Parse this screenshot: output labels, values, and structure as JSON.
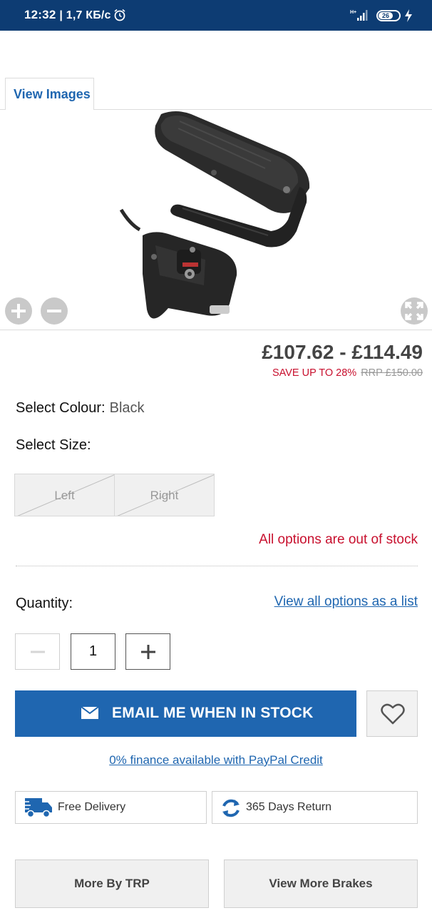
{
  "status_bar": {
    "time": "12:32",
    "speed": "| 1,7 КБ/с",
    "network": "H+",
    "battery": "26"
  },
  "tab": {
    "label": "View Images"
  },
  "price": {
    "range": "£107.62 - £114.49",
    "save": "SAVE UP TO 28%",
    "rrp": "RRP £150.00"
  },
  "colour": {
    "label": "Select Colour:",
    "value": "Black"
  },
  "size": {
    "label": "Select Size:",
    "options": [
      "Left",
      "Right"
    ]
  },
  "stock_message": "All options are out of stock",
  "quantity": {
    "label": "Quantity:",
    "value": "1",
    "view_list_link": "View all options as a list"
  },
  "email_button": "EMAIL ME WHEN IN STOCK",
  "finance_link": "0% finance available with PayPal Credit",
  "features": {
    "delivery": "Free Delivery",
    "returns": "365 Days Return"
  },
  "bottom_buttons": {
    "more_by": "More By TRP",
    "view_more": "View More Brakes"
  },
  "colors": {
    "status_bar": "#0d3c73",
    "accent_blue": "#1f66b0",
    "sale_red": "#c8102e"
  }
}
